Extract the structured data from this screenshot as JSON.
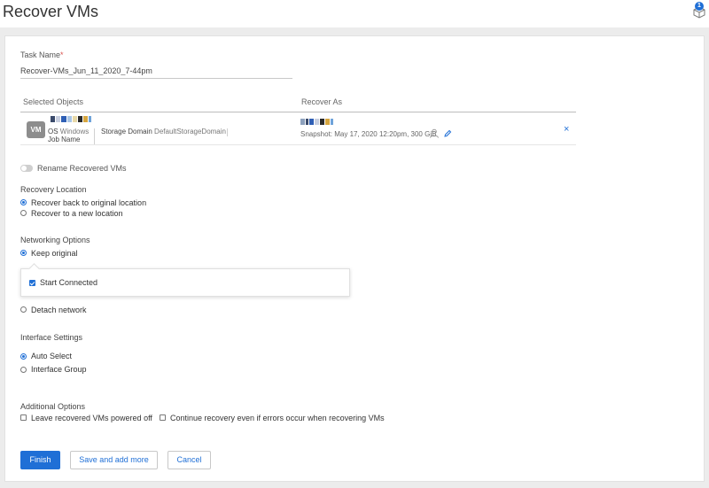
{
  "page": {
    "title": "Recover VMs",
    "notification_count": "1"
  },
  "task": {
    "label": "Task Name",
    "required_mark": "*",
    "value": "Recover-VMs_Jun_11_2020_7-44pm"
  },
  "table": {
    "col_selected": "Selected Objects",
    "col_recover_as": "Recover As",
    "row": {
      "badge": "VM",
      "os_label": "OS",
      "os_value": "Windows",
      "storage_label": "Storage Domain",
      "storage_value": "DefaultStorageDomain",
      "job_label": "Job Name",
      "snapshot": "Snapshot: May 17, 2020 12:20pm, 300 GiB",
      "remove": "×"
    }
  },
  "rename_toggle": {
    "label": "Rename Recovered VMs",
    "on": false
  },
  "recovery_location": {
    "title": "Recovery Location",
    "options": [
      "Recover back to original location",
      "Recover to a new location"
    ],
    "selected": 0
  },
  "networking": {
    "title": "Networking Options",
    "keep_original": "Keep original",
    "start_connected": "Start Connected",
    "detach": "Detach network"
  },
  "interface": {
    "title": "Interface Settings",
    "options": [
      "Auto Select",
      "Interface Group"
    ],
    "selected": 0
  },
  "additional": {
    "title": "Additional Options",
    "leave_powered_off": "Leave recovered VMs powered off",
    "continue_on_errors": "Continue recovery even if errors occur when recovering VMs"
  },
  "buttons": {
    "finish": "Finish",
    "save_add": "Save and add more",
    "cancel": "Cancel"
  },
  "colors": {
    "accent": "#1f6fd6",
    "background": "#ececec"
  }
}
